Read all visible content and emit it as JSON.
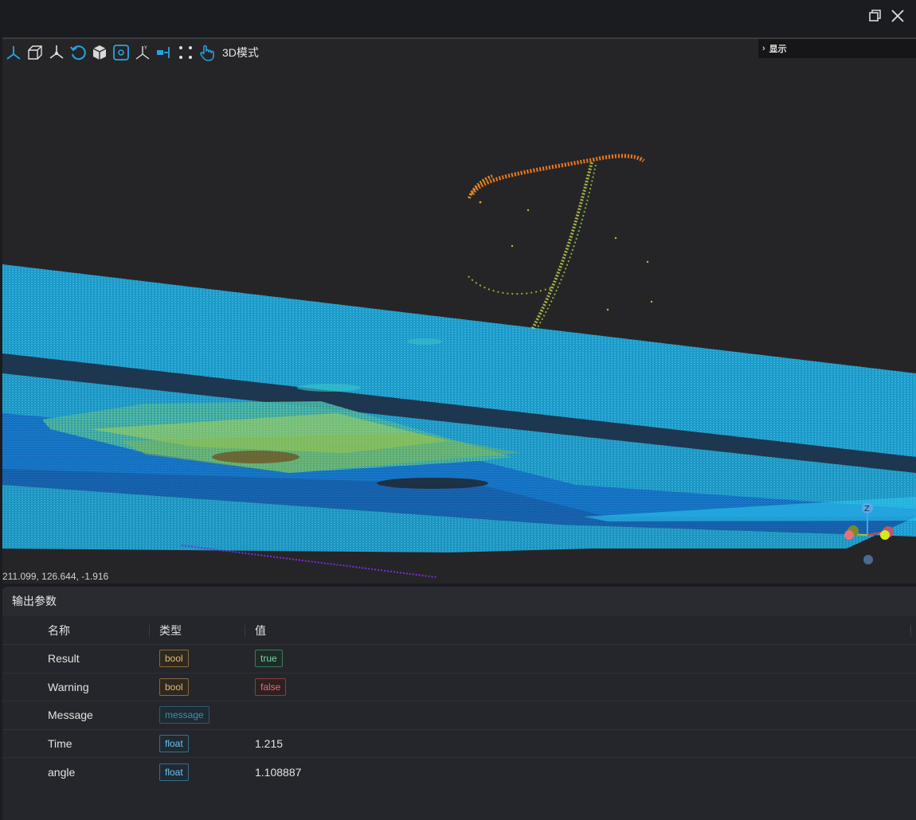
{
  "window": {
    "restore_icon": "restore-icon",
    "close_icon": "close-icon"
  },
  "viewer": {
    "toolbar": [
      {
        "icon": "axis-xyz-icon"
      },
      {
        "icon": "box-view-icon"
      },
      {
        "icon": "axis-tripod-icon"
      },
      {
        "icon": "rotate-reset-icon"
      },
      {
        "icon": "cube-icon"
      },
      {
        "icon": "fit-view-icon"
      },
      {
        "icon": "axis-yz-icon"
      },
      {
        "icon": "measure-icon"
      },
      {
        "icon": "points-icon"
      },
      {
        "icon": "hand-pan-icon"
      }
    ],
    "mode_label": "3D模式",
    "display_panel_label": "显示",
    "coordinate_readout": "211.099, 126.644, -1.916",
    "gizmo_z_label": "Z",
    "colors": {
      "accent": "#2aa3e0",
      "cloud_blue": "#1fb3e8",
      "cloud_deep": "#1370d6",
      "cloud_green": "#8fd04a",
      "cloud_orange": "#f07a1e"
    }
  },
  "output_params": {
    "title": "输出参数",
    "columns": {
      "name": "名称",
      "type": "类型",
      "value": "值"
    },
    "rows": [
      {
        "name": "Result",
        "type": "bool",
        "value": "true",
        "value_style": "tag-true"
      },
      {
        "name": "Warning",
        "type": "bool",
        "value": "false",
        "value_style": "tag-false"
      },
      {
        "name": "Message",
        "type": "message",
        "value": "",
        "value_style": ""
      },
      {
        "name": "Time",
        "type": "float",
        "value": "1.215",
        "value_style": "text"
      },
      {
        "name": "angle",
        "type": "float",
        "value": "1.108887",
        "value_style": "text"
      }
    ]
  }
}
